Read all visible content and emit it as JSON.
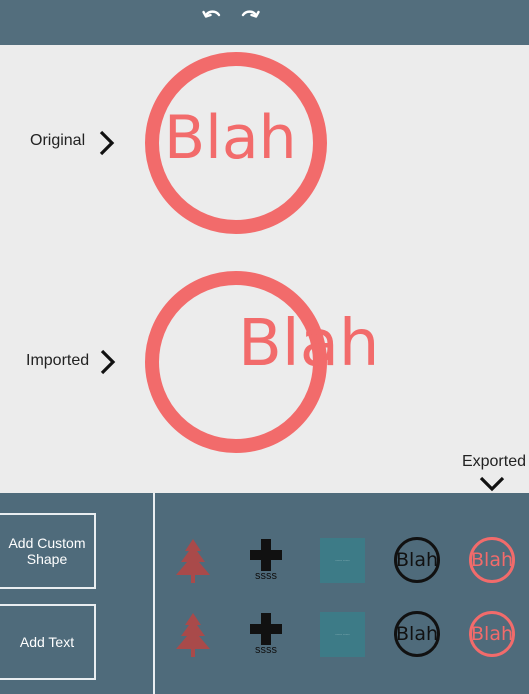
{
  "toolbar": {
    "undo_icon": "undo-icon",
    "redo_icon": "redo-icon"
  },
  "canvas": {
    "original_label": "Original",
    "imported_label": "Imported",
    "original_text": "Blah",
    "imported_text": "Blah",
    "exported_label": "Exported"
  },
  "side_buttons": {
    "add_custom_shape": "Add Custom Shape",
    "add_text": "Add Text"
  },
  "thumbnails": {
    "plus_label_1": "ssss",
    "plus_label_2": "ssss",
    "square_text_1": "----- -----",
    "square_text_2": "----- -----",
    "black_circle_text_1": "Blah",
    "black_circle_text_2": "Blah",
    "red_circle_text_1": "Blah",
    "red_circle_text_2": "Blah"
  },
  "colors": {
    "accent_red": "#f26b6b",
    "tree_red": "#a94a4a",
    "teal": "#3d7b87",
    "panel": "#4f6b7b"
  }
}
